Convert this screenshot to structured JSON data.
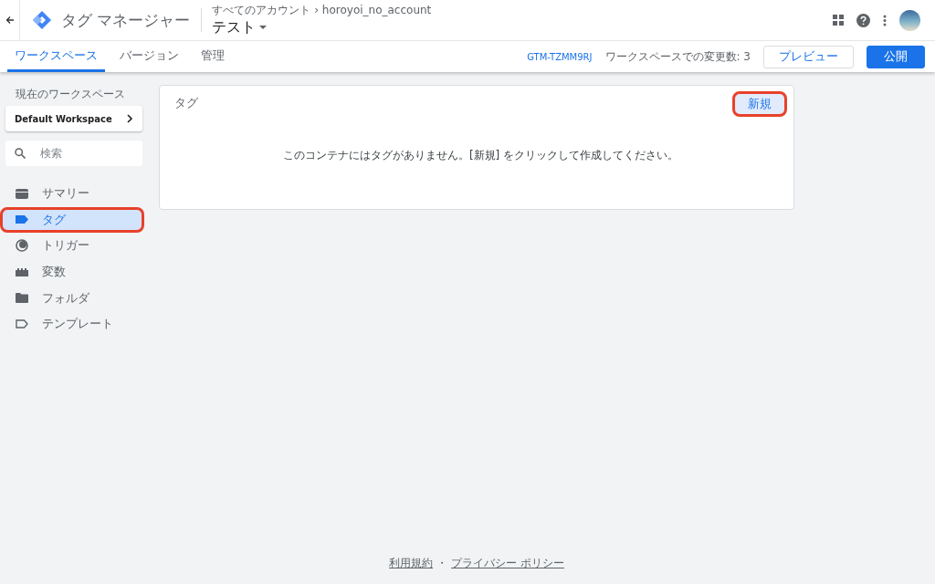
{
  "header": {
    "app_title": "タグ マネージャー",
    "breadcrumb": "すべてのアカウント › horoyoi_no_account",
    "container_name": "テスト"
  },
  "tabs": [
    {
      "label": "ワークスペース",
      "selected": true
    },
    {
      "label": "バージョン",
      "selected": false
    },
    {
      "label": "管理",
      "selected": false
    }
  ],
  "container_id": "GTM-TZMM9RJ",
  "changes": "ワークスペースでの変更数: 3",
  "preview_button": "プレビュー",
  "publish_button": "公開",
  "sidebar": {
    "workspace_label": "現在のワークスペース",
    "workspace_name": "Default Workspace",
    "search_placeholder": "検索",
    "items": [
      {
        "label": "サマリー",
        "kind": "summary",
        "selected": false,
        "highlighted": false
      },
      {
        "label": "タグ",
        "kind": "tag",
        "selected": true,
        "highlighted": true
      },
      {
        "label": "トリガー",
        "kind": "trigger",
        "selected": false,
        "highlighted": false
      },
      {
        "label": "変数",
        "kind": "variable",
        "selected": false,
        "highlighted": false
      },
      {
        "label": "フォルダ",
        "kind": "folder",
        "selected": false,
        "highlighted": false
      },
      {
        "label": "テンプレート",
        "kind": "template",
        "selected": false,
        "highlighted": false
      }
    ]
  },
  "card": {
    "title": "タグ",
    "new_button": "新規",
    "new_button_highlighted": true,
    "empty_message": "このコンテナにはタグがありません。[新規] をクリックして作成してください。"
  },
  "footer": {
    "terms": "利用規約",
    "separator": "・",
    "privacy": "プライバシー ポリシー"
  }
}
